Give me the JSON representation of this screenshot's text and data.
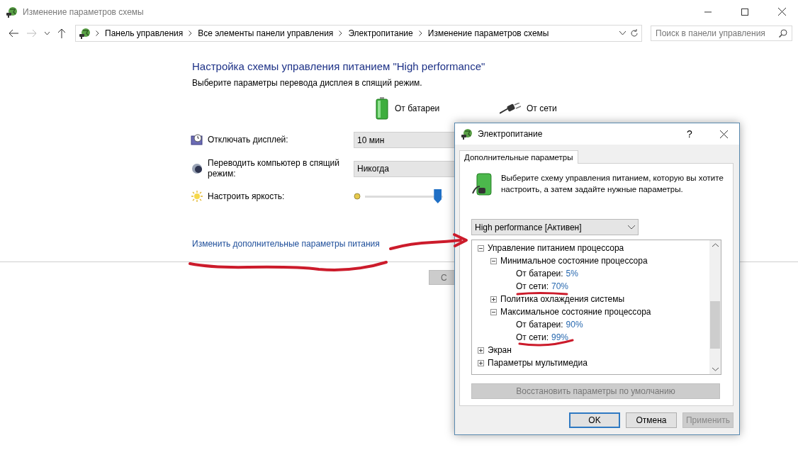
{
  "window": {
    "title": "Изменение параметров схемы"
  },
  "address_bar": {
    "path": [
      "Панель управления",
      "Все элементы панели управления",
      "Электропитание",
      "Изменение параметров схемы"
    ]
  },
  "search": {
    "placeholder": "Поиск в панели управления"
  },
  "heading": "Настройка схемы управления питанием \"High performance\"",
  "subheading": "Выберите параметры перевода дисплея в спящий режим.",
  "columns": [
    "От батареи",
    "От сети"
  ],
  "settings": [
    {
      "kind": "dropdown",
      "label": "Отключать дисплей:",
      "value": "10 мин"
    },
    {
      "kind": "dropdown",
      "label": "Переводить компьютер в спящий режим:",
      "value": "Никогда"
    },
    {
      "kind": "slider",
      "label": "Настроить яркость:",
      "level": 0.93
    }
  ],
  "advanced_link": "Изменить дополнительные параметры питания",
  "save_button": "С",
  "dialog": {
    "title": "Электропитание",
    "help": "?",
    "tabs": [
      {
        "label": "Дополнительные параметры",
        "selected": true
      }
    ],
    "intro": "Выберите схему управления питанием, которую вы хотите настроить, а затем задайте нужные параметры.",
    "plan": "High performance [Активен]",
    "tree": [
      {
        "label": "Управление питанием процессора",
        "expanded": true,
        "children": [
          {
            "label": "Минимальное состояние процессора",
            "expanded": true,
            "children": [
              {
                "label": "От батареи:",
                "value": "5%"
              },
              {
                "label": "От сети:",
                "value": "70%"
              }
            ]
          },
          {
            "label": "Политика охлаждения системы",
            "expanded": false
          },
          {
            "label": "Максимальное состояние процессора",
            "expanded": true,
            "children": [
              {
                "label": "От батареи:",
                "value": "90%"
              },
              {
                "label": "От сети:",
                "value": "99%"
              }
            ]
          }
        ]
      },
      {
        "label": "Экран",
        "expanded": false
      },
      {
        "label": "Параметры мультимедиа",
        "expanded": false
      }
    ],
    "restore_button": "Восстановить параметры по умолчанию",
    "buttons": [
      {
        "label": "OK",
        "kind": "default"
      },
      {
        "label": "Отмена",
        "kind": "normal"
      },
      {
        "label": "Применить",
        "kind": "disabled"
      }
    ]
  }
}
